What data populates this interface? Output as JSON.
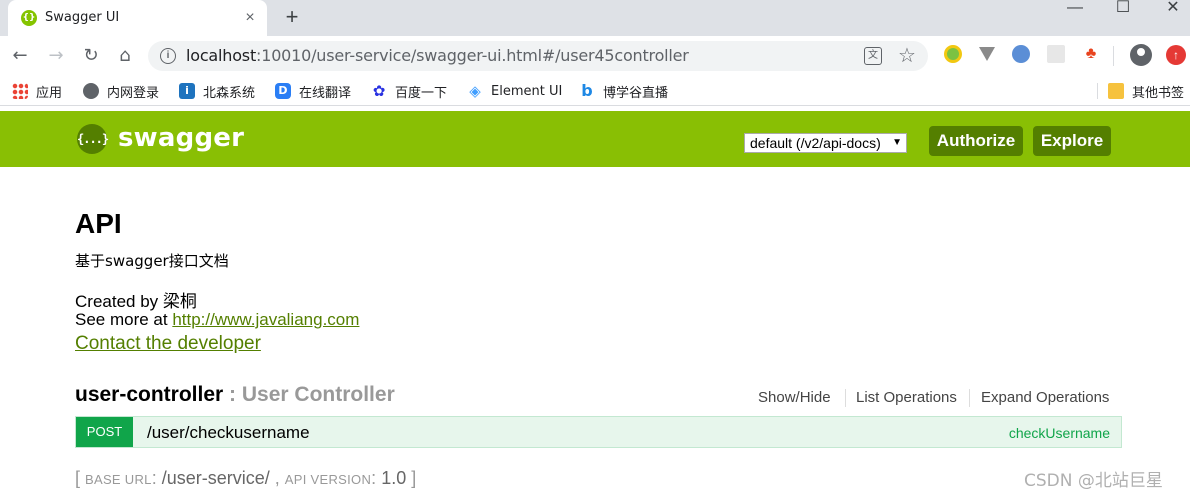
{
  "browser": {
    "tab": {
      "title": "Swagger UI",
      "favicon": "swagger-favicon",
      "close": "×"
    },
    "new_tab": "+",
    "window_controls": {
      "minimize": "—",
      "maximize": "☐",
      "close": "✕"
    },
    "nav": {
      "back": "←",
      "forward": "→",
      "reload": "↻",
      "home": "⌂"
    },
    "url": {
      "host": "localhost",
      "path": ":10010/user-service/swagger-ui.html#/user45controller"
    },
    "bookmarks": [
      {
        "label": "应用",
        "icon": "apps-grid-icon"
      },
      {
        "label": "内网登录",
        "icon": "globe-icon"
      },
      {
        "label": "北森系统",
        "icon": "beisen-icon"
      },
      {
        "label": "在线翻译",
        "icon": "translate-d-icon"
      },
      {
        "label": "百度一下",
        "icon": "baidu-paw-icon"
      },
      {
        "label": "Element UI",
        "icon": "element-icon"
      },
      {
        "label": "博学谷直播",
        "icon": "bilibili-icon"
      }
    ],
    "other_bookmarks": "其他书签"
  },
  "swagger": {
    "logo_text": "swagger",
    "logo_icon_glyph": "{...}",
    "spec_select": "default (/v2/api-docs)",
    "authorize": "Authorize",
    "explore": "Explore",
    "brand_color": "#89bf04",
    "button_color": "#547f00"
  },
  "api": {
    "title": "API",
    "description": "基于swagger接口文档",
    "created_by": "Created by 梁桐",
    "see_more_prefix": "See more at ",
    "see_more_link": "http://www.javaliang.com",
    "contact": "Contact the developer"
  },
  "resource": {
    "name": "user-controller",
    "separator": " : ",
    "description": "User Controller",
    "actions": [
      "Show/Hide",
      "List Operations",
      "Expand Operations"
    ],
    "operations": [
      {
        "method": "POST",
        "path": "/user/checkusername",
        "nickname": "checkUsername",
        "method_color": "#10a54a"
      }
    ]
  },
  "footer": {
    "open": "[ ",
    "base_url_label": "BASE URL",
    "base_url_value": "/user-service/",
    "api_version_label": "API VERSION",
    "api_version_value": "1.0",
    "close": " ]"
  },
  "watermark": "CSDN @北站巨星"
}
